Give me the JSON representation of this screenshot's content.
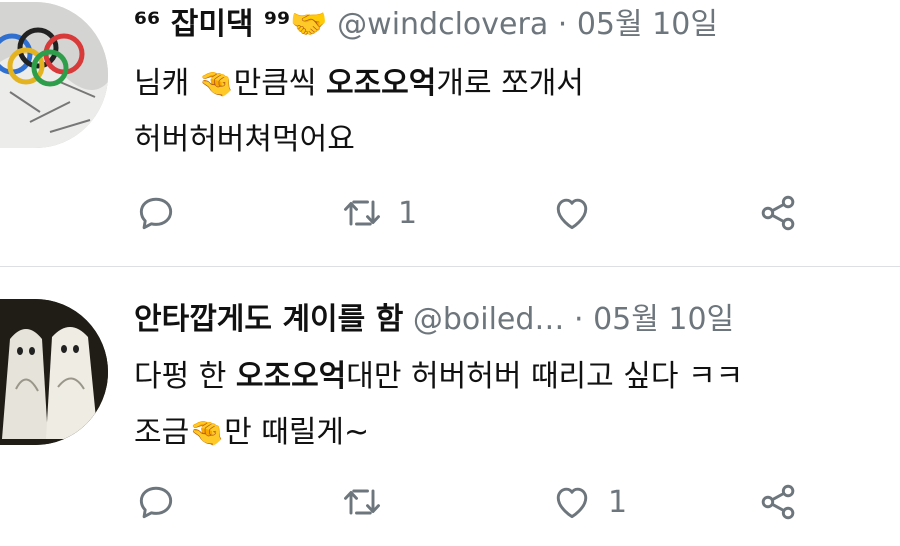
{
  "colors": {
    "text": "#111111",
    "muted": "#6e767d",
    "divider": "#dcdfe3",
    "emoji": "#f2b632"
  },
  "tweets": [
    {
      "name": "⁶⁶ 잡미댁 ⁹⁹",
      "name_emoji": "handshake-emoji",
      "handle": "@windclovera",
      "dot": "·",
      "date": "05월 10일",
      "line1_a": "님캐 ",
      "line1_b": "만큼씩 ",
      "line1_bold": "오조오억",
      "line1_c": "개로 쪼개서",
      "line2": "허버허버쳐먹어요",
      "inline_emoji": "pinching-hand-emoji",
      "retweets": "1",
      "likes": ""
    },
    {
      "name": "안타깝게도 계이를 함",
      "handle": "@boiled…",
      "dot": "·",
      "date": "05월 10일",
      "line1_a": "다펑 한 ",
      "line1_bold": "오조오억",
      "line1_c": "대만 허버허버 때리고 싶다 ㅋㅋ",
      "line2_a": "조금",
      "line2_b": "만 때릴게~",
      "inline_emoji": "pinching-hand-emoji",
      "retweets": "",
      "likes": "1"
    }
  ],
  "icons": [
    "reply-icon",
    "retweet-icon",
    "like-icon",
    "share-icon"
  ]
}
